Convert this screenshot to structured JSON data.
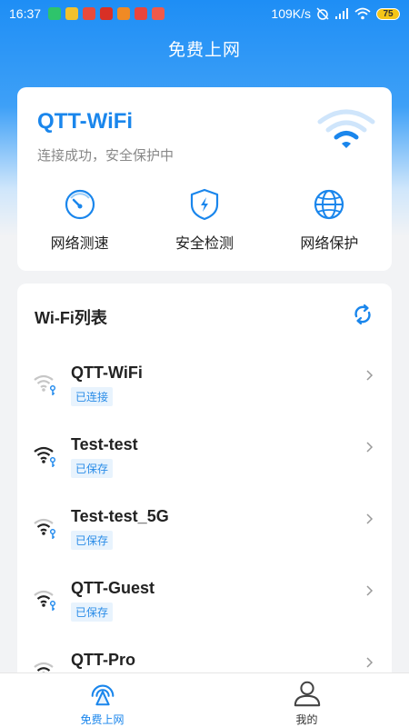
{
  "status_bar": {
    "time": "16:37",
    "network_speed": "109K/s",
    "battery": "75"
  },
  "header": {
    "title": "免费上网"
  },
  "connection": {
    "ssid": "QTT-WiFi",
    "status": "连接成功，安全保护中",
    "actions": [
      {
        "label": "网络测速",
        "icon": "speedometer-icon"
      },
      {
        "label": "安全检测",
        "icon": "shield-icon"
      },
      {
        "label": "网络保护",
        "icon": "globe-icon"
      }
    ]
  },
  "wifi_list": {
    "title": "Wi-Fi列表",
    "items": [
      {
        "name": "QTT-WiFi",
        "badge": "已连接"
      },
      {
        "name": "Test-test",
        "badge": "已保存"
      },
      {
        "name": "Test-test_5G",
        "badge": "已保存"
      },
      {
        "name": "QTT-Guest",
        "badge": "已保存"
      },
      {
        "name": "QTT-Pro",
        "badge": ""
      }
    ]
  },
  "bottom_nav": [
    {
      "label": "免费上网",
      "active": true
    },
    {
      "label": "我的",
      "active": false
    }
  ],
  "colors": {
    "accent": "#1a86ec",
    "badge_bg": "#e8f3fd"
  }
}
